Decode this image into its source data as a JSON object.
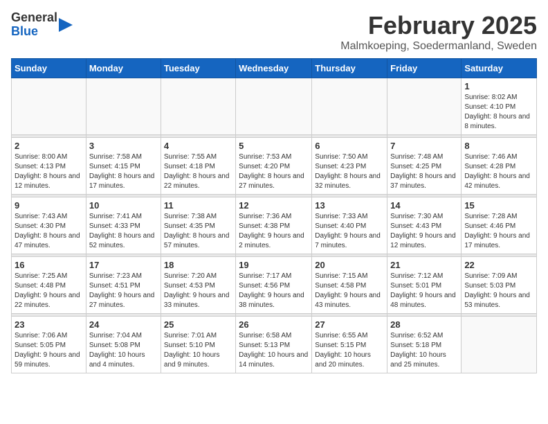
{
  "logo": {
    "general": "General",
    "blue": "Blue"
  },
  "title": "February 2025",
  "location": "Malmkoeping, Soedermanland, Sweden",
  "days_of_week": [
    "Sunday",
    "Monday",
    "Tuesday",
    "Wednesday",
    "Thursday",
    "Friday",
    "Saturday"
  ],
  "weeks": [
    [
      {
        "day": "",
        "info": ""
      },
      {
        "day": "",
        "info": ""
      },
      {
        "day": "",
        "info": ""
      },
      {
        "day": "",
        "info": ""
      },
      {
        "day": "",
        "info": ""
      },
      {
        "day": "",
        "info": ""
      },
      {
        "day": "1",
        "info": "Sunrise: 8:02 AM\nSunset: 4:10 PM\nDaylight: 8 hours and 8 minutes."
      }
    ],
    [
      {
        "day": "2",
        "info": "Sunrise: 8:00 AM\nSunset: 4:13 PM\nDaylight: 8 hours and 12 minutes."
      },
      {
        "day": "3",
        "info": "Sunrise: 7:58 AM\nSunset: 4:15 PM\nDaylight: 8 hours and 17 minutes."
      },
      {
        "day": "4",
        "info": "Sunrise: 7:55 AM\nSunset: 4:18 PM\nDaylight: 8 hours and 22 minutes."
      },
      {
        "day": "5",
        "info": "Sunrise: 7:53 AM\nSunset: 4:20 PM\nDaylight: 8 hours and 27 minutes."
      },
      {
        "day": "6",
        "info": "Sunrise: 7:50 AM\nSunset: 4:23 PM\nDaylight: 8 hours and 32 minutes."
      },
      {
        "day": "7",
        "info": "Sunrise: 7:48 AM\nSunset: 4:25 PM\nDaylight: 8 hours and 37 minutes."
      },
      {
        "day": "8",
        "info": "Sunrise: 7:46 AM\nSunset: 4:28 PM\nDaylight: 8 hours and 42 minutes."
      }
    ],
    [
      {
        "day": "9",
        "info": "Sunrise: 7:43 AM\nSunset: 4:30 PM\nDaylight: 8 hours and 47 minutes."
      },
      {
        "day": "10",
        "info": "Sunrise: 7:41 AM\nSunset: 4:33 PM\nDaylight: 8 hours and 52 minutes."
      },
      {
        "day": "11",
        "info": "Sunrise: 7:38 AM\nSunset: 4:35 PM\nDaylight: 8 hours and 57 minutes."
      },
      {
        "day": "12",
        "info": "Sunrise: 7:36 AM\nSunset: 4:38 PM\nDaylight: 9 hours and 2 minutes."
      },
      {
        "day": "13",
        "info": "Sunrise: 7:33 AM\nSunset: 4:40 PM\nDaylight: 9 hours and 7 minutes."
      },
      {
        "day": "14",
        "info": "Sunrise: 7:30 AM\nSunset: 4:43 PM\nDaylight: 9 hours and 12 minutes."
      },
      {
        "day": "15",
        "info": "Sunrise: 7:28 AM\nSunset: 4:46 PM\nDaylight: 9 hours and 17 minutes."
      }
    ],
    [
      {
        "day": "16",
        "info": "Sunrise: 7:25 AM\nSunset: 4:48 PM\nDaylight: 9 hours and 22 minutes."
      },
      {
        "day": "17",
        "info": "Sunrise: 7:23 AM\nSunset: 4:51 PM\nDaylight: 9 hours and 27 minutes."
      },
      {
        "day": "18",
        "info": "Sunrise: 7:20 AM\nSunset: 4:53 PM\nDaylight: 9 hours and 33 minutes."
      },
      {
        "day": "19",
        "info": "Sunrise: 7:17 AM\nSunset: 4:56 PM\nDaylight: 9 hours and 38 minutes."
      },
      {
        "day": "20",
        "info": "Sunrise: 7:15 AM\nSunset: 4:58 PM\nDaylight: 9 hours and 43 minutes."
      },
      {
        "day": "21",
        "info": "Sunrise: 7:12 AM\nSunset: 5:01 PM\nDaylight: 9 hours and 48 minutes."
      },
      {
        "day": "22",
        "info": "Sunrise: 7:09 AM\nSunset: 5:03 PM\nDaylight: 9 hours and 53 minutes."
      }
    ],
    [
      {
        "day": "23",
        "info": "Sunrise: 7:06 AM\nSunset: 5:05 PM\nDaylight: 9 hours and 59 minutes."
      },
      {
        "day": "24",
        "info": "Sunrise: 7:04 AM\nSunset: 5:08 PM\nDaylight: 10 hours and 4 minutes."
      },
      {
        "day": "25",
        "info": "Sunrise: 7:01 AM\nSunset: 5:10 PM\nDaylight: 10 hours and 9 minutes."
      },
      {
        "day": "26",
        "info": "Sunrise: 6:58 AM\nSunset: 5:13 PM\nDaylight: 10 hours and 14 minutes."
      },
      {
        "day": "27",
        "info": "Sunrise: 6:55 AM\nSunset: 5:15 PM\nDaylight: 10 hours and 20 minutes."
      },
      {
        "day": "28",
        "info": "Sunrise: 6:52 AM\nSunset: 5:18 PM\nDaylight: 10 hours and 25 minutes."
      },
      {
        "day": "",
        "info": ""
      }
    ]
  ]
}
